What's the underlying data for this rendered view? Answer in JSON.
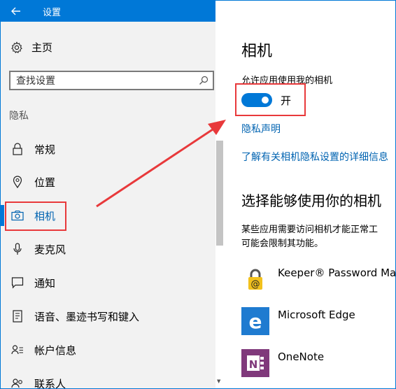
{
  "window": {
    "title": "设置",
    "accent_color": "#0078d7"
  },
  "sidebar": {
    "home_label": "主页",
    "search_placeholder": "查找设置",
    "section_label": "隐私",
    "items": [
      {
        "label": "常规",
        "icon": "lock-icon"
      },
      {
        "label": "位置",
        "icon": "location-icon"
      },
      {
        "label": "相机",
        "icon": "camera-icon",
        "selected": true
      },
      {
        "label": "麦克风",
        "icon": "microphone-icon"
      },
      {
        "label": "通知",
        "icon": "notification-icon"
      },
      {
        "label": "语音、墨迹书写和键入",
        "icon": "speech-icon"
      },
      {
        "label": "帐户信息",
        "icon": "account-icon"
      },
      {
        "label": "联系人",
        "icon": "contacts-icon"
      }
    ]
  },
  "content": {
    "title": "相机",
    "allow_label": "允许应用使用我的相机",
    "toggle_on": true,
    "toggle_state": "开",
    "privacy_link": "隐私声明",
    "learn_more_link": "了解有关相机隐私设置的详细信息",
    "choose_title": "选择能够使用你的相机",
    "description_line1": "某些应用需要访问相机才能正常工",
    "description_line2": "可能会限制其功能。",
    "apps": [
      {
        "name": "Keeper® Password Man",
        "icon": "keeper-icon"
      },
      {
        "name": "Microsoft Edge",
        "icon": "edge-icon"
      },
      {
        "name": "OneNote",
        "icon": "onenote-icon"
      }
    ]
  },
  "annotation": {
    "highlight_color": "#e8393b"
  }
}
